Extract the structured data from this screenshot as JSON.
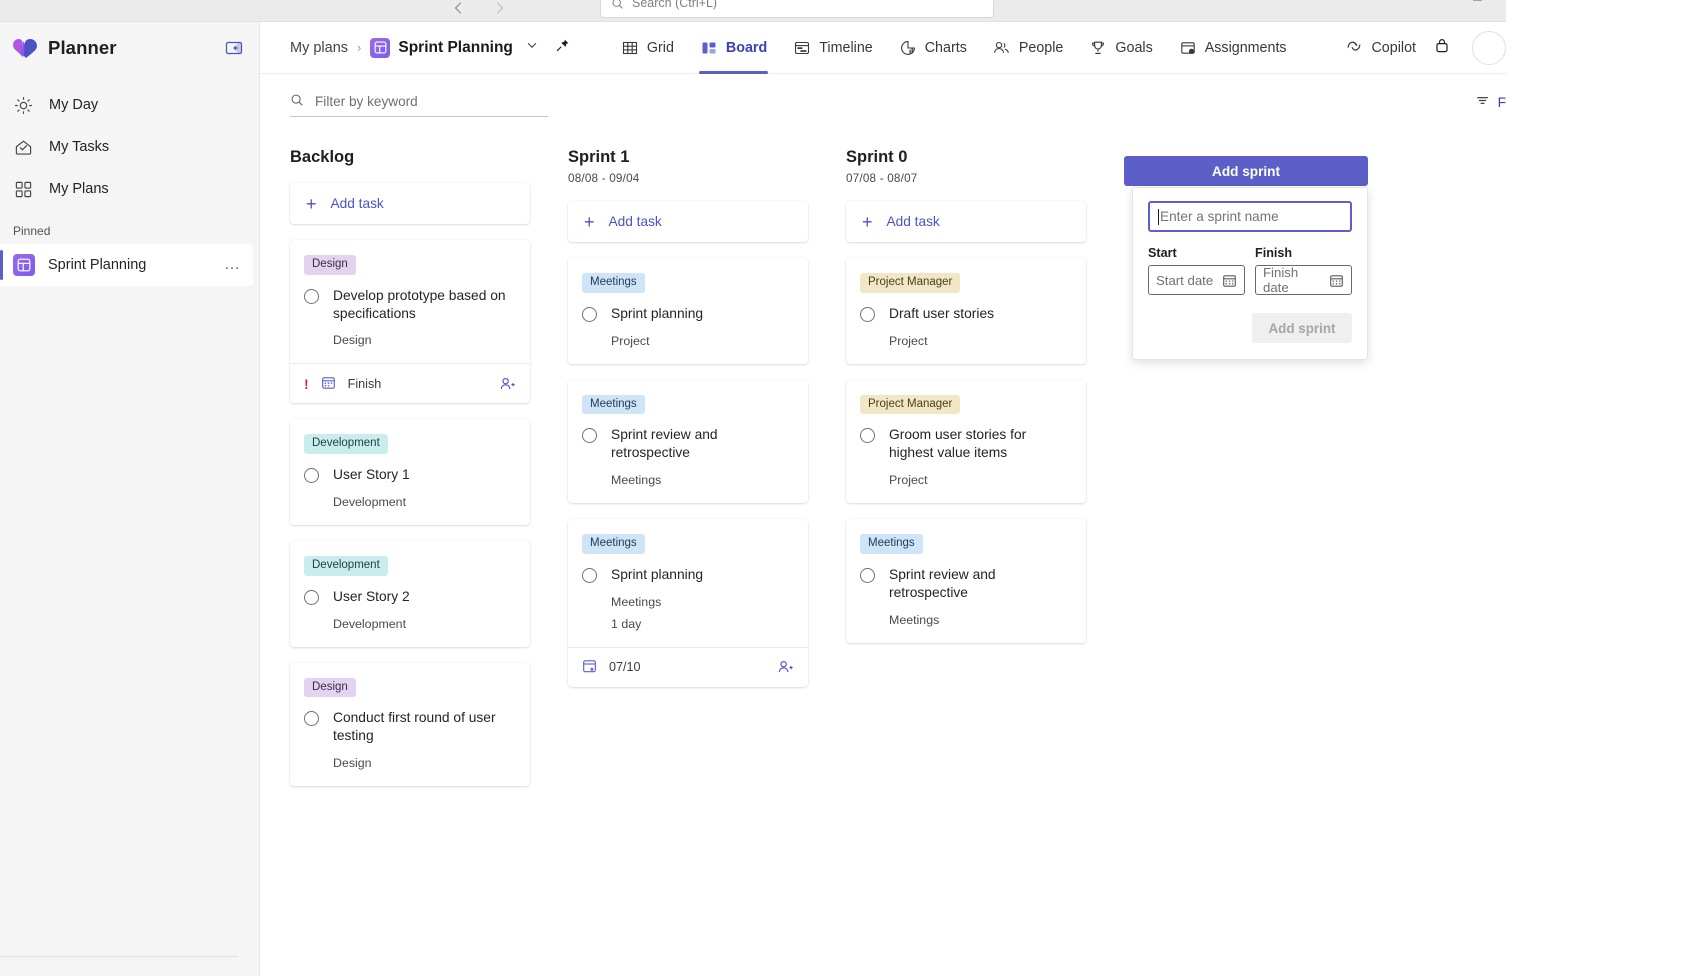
{
  "app": {
    "strip_search_placeholder": "Search (Ctrl+L)",
    "brand": "Planner"
  },
  "sidebar": {
    "collapse_label": "",
    "items": [
      {
        "label": "My Day",
        "icon": "sun-icon"
      },
      {
        "label": "My Tasks",
        "icon": "tasks-inbox-icon"
      },
      {
        "label": "My Plans",
        "icon": "grid-squares-icon"
      }
    ],
    "section_label": "Pinned",
    "pinned": [
      {
        "label": "Sprint Planning",
        "overflow": "…"
      }
    ]
  },
  "topbar": {
    "breadcrumb_root": "My plans",
    "breadcrumb_sep": "›",
    "plan_title": "Sprint Planning",
    "tabs": [
      {
        "label": "Grid",
        "icon": "grid-icon",
        "active": false
      },
      {
        "label": "Board",
        "icon": "board-icon",
        "active": true
      },
      {
        "label": "Timeline",
        "icon": "timeline-icon",
        "active": false
      },
      {
        "label": "Charts",
        "icon": "charts-icon",
        "active": false
      },
      {
        "label": "People",
        "icon": "people-icon",
        "active": false
      },
      {
        "label": "Goals",
        "icon": "trophy-icon",
        "active": false
      },
      {
        "label": "Assignments",
        "icon": "assignments-icon",
        "active": false
      }
    ],
    "copilot_label": "Copilot",
    "lock_icon": "lock-icon"
  },
  "filters": {
    "search_placeholder": "Filter by keyword",
    "filter_label": "F"
  },
  "board": {
    "columns": [
      {
        "title": "Backlog",
        "subtitle": "",
        "add_task_label": "Add task",
        "tasks": [
          {
            "chip": "Design",
            "chip_class": "design",
            "title": "Develop prototype based on specifications",
            "meta": [
              "Design"
            ],
            "footer": {
              "priority": "!",
              "icon": "calendar-icon",
              "label": "Finish",
              "assign_icon": "assign-person-icon"
            }
          },
          {
            "chip": "Development",
            "chip_class": "development",
            "title": "User Story 1",
            "meta": [
              "Development"
            ],
            "footer": null
          },
          {
            "chip": "Development",
            "chip_class": "development",
            "title": "User Story 2",
            "meta": [
              "Development"
            ],
            "footer": null
          },
          {
            "chip": "Design",
            "chip_class": "design",
            "title": "Conduct first round of user testing",
            "meta": [
              "Design"
            ],
            "footer": null
          }
        ]
      },
      {
        "title": "Sprint 1",
        "subtitle": "08/08 - 09/04",
        "add_task_label": "Add task",
        "tasks": [
          {
            "chip": "Meetings",
            "chip_class": "meetings",
            "title": "Sprint planning",
            "meta": [
              "Project"
            ],
            "footer": null
          },
          {
            "chip": "Meetings",
            "chip_class": "meetings",
            "title": "Sprint review and retrospective",
            "meta": [
              "Meetings"
            ],
            "footer": null
          },
          {
            "chip": "Meetings",
            "chip_class": "meetings",
            "title": "Sprint planning",
            "meta": [
              "Meetings",
              "1 day"
            ],
            "footer": {
              "priority": "",
              "icon": "calendar-start-icon",
              "label": "07/10",
              "assign_icon": "assign-person-icon"
            }
          }
        ]
      },
      {
        "title": "Sprint 0",
        "subtitle": "07/08 - 08/07",
        "add_task_label": "Add task",
        "tasks": [
          {
            "chip": "Project Manager",
            "chip_class": "pm",
            "title": "Draft user stories",
            "meta": [
              "Project"
            ],
            "footer": null
          },
          {
            "chip": "Project Manager",
            "chip_class": "pm",
            "title": "Groom user stories for highest value items",
            "meta": [
              "Project"
            ],
            "footer": null
          },
          {
            "chip": "Meetings",
            "chip_class": "meetings",
            "title": "Sprint review and retrospective",
            "meta": [
              "Meetings"
            ],
            "footer": null
          }
        ]
      }
    ]
  },
  "add_sprint": {
    "button_label": "Add sprint",
    "name_placeholder": "Enter a sprint name",
    "name_value": "",
    "start_label": "Start",
    "finish_label": "Finish",
    "start_placeholder": "Start date",
    "finish_placeholder": "Finish date",
    "submit_label": "Add sprint"
  },
  "colors": {
    "accent": "#5b5fc7",
    "accent_text": "#3c41b3",
    "urgent": "#c4314b"
  }
}
